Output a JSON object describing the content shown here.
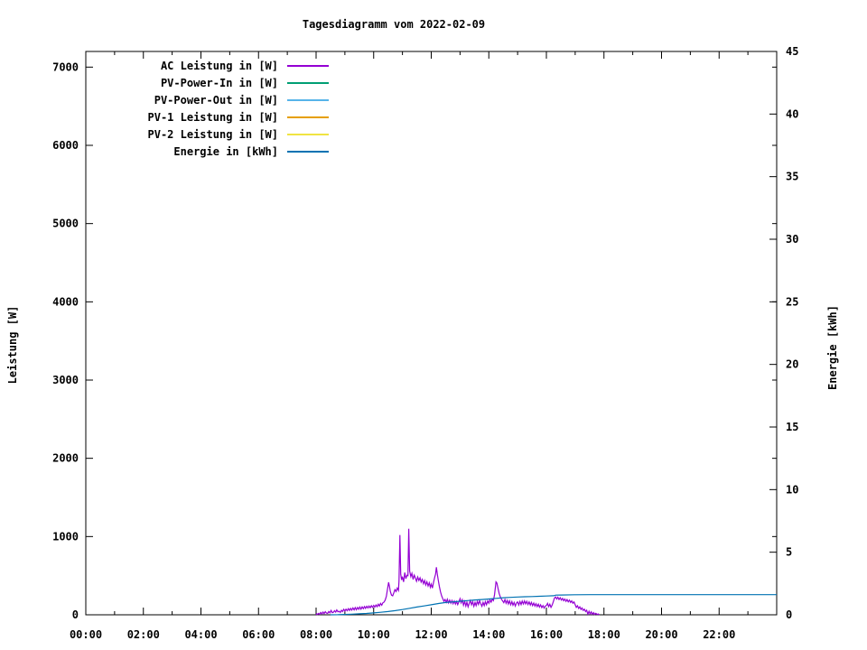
{
  "chart_data": {
    "type": "line",
    "title": "Tagesdiagramm vom 2022-02-09",
    "legend_position": "top-left",
    "grid": false,
    "background": "#ffffff",
    "x": {
      "min": 0,
      "max": 24,
      "major": [
        0,
        2,
        4,
        6,
        8,
        10,
        12,
        14,
        16,
        18,
        20,
        22
      ],
      "major_labels": [
        "00:00",
        "02:00",
        "04:00",
        "06:00",
        "08:00",
        "10:00",
        "12:00",
        "14:00",
        "16:00",
        "18:00",
        "20:00",
        "22:00"
      ],
      "minor": [
        1,
        3,
        5,
        7,
        9,
        11,
        13,
        15,
        17,
        19,
        21,
        23
      ]
    },
    "y_left": {
      "label": "Leistung [W]",
      "min": 0,
      "max": 7200,
      "ticks": [
        0,
        1000,
        2000,
        3000,
        4000,
        5000,
        6000,
        7000
      ]
    },
    "y_right": {
      "label": "Energie [kWh]",
      "min": 0,
      "max": 45,
      "ticks": [
        0,
        5,
        10,
        15,
        20,
        25,
        30,
        35,
        40,
        45
      ]
    },
    "series": [
      {
        "name": "AC Leistung in [W]",
        "color": "#9400d3",
        "axis": "left",
        "points": [
          [
            8.0,
            0
          ],
          [
            8.02,
            12
          ],
          [
            8.04,
            3
          ],
          [
            8.08,
            18
          ],
          [
            8.12,
            6
          ],
          [
            8.16,
            30
          ],
          [
            8.2,
            12
          ],
          [
            8.24,
            35
          ],
          [
            8.28,
            15
          ],
          [
            8.32,
            40
          ],
          [
            8.36,
            22
          ],
          [
            8.4,
            18
          ],
          [
            8.44,
            42
          ],
          [
            8.48,
            25
          ],
          [
            8.52,
            55
          ],
          [
            8.56,
            28
          ],
          [
            8.6,
            32
          ],
          [
            8.64,
            52
          ],
          [
            8.68,
            35
          ],
          [
            8.72,
            62
          ],
          [
            8.76,
            38
          ],
          [
            8.8,
            45
          ],
          [
            8.84,
            30
          ],
          [
            8.88,
            58
          ],
          [
            8.92,
            42
          ],
          [
            8.96,
            70
          ],
          [
            9.0,
            48
          ],
          [
            9.04,
            72
          ],
          [
            9.08,
            52
          ],
          [
            9.12,
            78
          ],
          [
            9.16,
            55
          ],
          [
            9.2,
            82
          ],
          [
            9.24,
            60
          ],
          [
            9.28,
            88
          ],
          [
            9.32,
            62
          ],
          [
            9.36,
            92
          ],
          [
            9.4,
            65
          ],
          [
            9.44,
            95
          ],
          [
            9.48,
            70
          ],
          [
            9.52,
            100
          ],
          [
            9.56,
            72
          ],
          [
            9.6,
            102
          ],
          [
            9.64,
            78
          ],
          [
            9.68,
            106
          ],
          [
            9.72,
            82
          ],
          [
            9.76,
            110
          ],
          [
            9.8,
            86
          ],
          [
            9.84,
            112
          ],
          [
            9.88,
            90
          ],
          [
            9.92,
            116
          ],
          [
            9.96,
            95
          ],
          [
            10.0,
            120
          ],
          [
            10.04,
            98
          ],
          [
            10.08,
            126
          ],
          [
            10.12,
            104
          ],
          [
            10.16,
            135
          ],
          [
            10.2,
            112
          ],
          [
            10.24,
            145
          ],
          [
            10.28,
            122
          ],
          [
            10.32,
            152
          ],
          [
            10.36,
            162
          ],
          [
            10.4,
            188
          ],
          [
            10.44,
            235
          ],
          [
            10.48,
            330
          ],
          [
            10.52,
            415
          ],
          [
            10.55,
            360
          ],
          [
            10.58,
            298
          ],
          [
            10.62,
            252
          ],
          [
            10.66,
            242
          ],
          [
            10.7,
            282
          ],
          [
            10.74,
            322
          ],
          [
            10.78,
            298
          ],
          [
            10.82,
            342
          ],
          [
            10.86,
            312
          ],
          [
            10.88,
            430
          ],
          [
            10.91,
            1020
          ],
          [
            10.94,
            520
          ],
          [
            10.97,
            445
          ],
          [
            11.0,
            488
          ],
          [
            11.04,
            420
          ],
          [
            11.08,
            540
          ],
          [
            11.12,
            462
          ],
          [
            11.16,
            505
          ],
          [
            11.19,
            500
          ],
          [
            11.22,
            1100
          ],
          [
            11.25,
            560
          ],
          [
            11.29,
            488
          ],
          [
            11.33,
            530
          ],
          [
            11.37,
            452
          ],
          [
            11.41,
            508
          ],
          [
            11.45,
            468
          ],
          [
            11.49,
            428
          ],
          [
            11.53,
            482
          ],
          [
            11.57,
            438
          ],
          [
            11.61,
            472
          ],
          [
            11.65,
            418
          ],
          [
            11.69,
            452
          ],
          [
            11.73,
            398
          ],
          [
            11.77,
            438
          ],
          [
            11.81,
            382
          ],
          [
            11.85,
            422
          ],
          [
            11.89,
            368
          ],
          [
            11.93,
            408
          ],
          [
            11.97,
            352
          ],
          [
            12.0,
            392
          ],
          [
            12.04,
            342
          ],
          [
            12.08,
            418
          ],
          [
            12.12,
            478
          ],
          [
            12.15,
            520
          ],
          [
            12.18,
            608
          ],
          [
            12.21,
            522
          ],
          [
            12.24,
            448
          ],
          [
            12.28,
            368
          ],
          [
            12.32,
            295
          ],
          [
            12.36,
            242
          ],
          [
            12.4,
            205
          ],
          [
            12.44,
            172
          ],
          [
            12.48,
            195
          ],
          [
            12.52,
            158
          ],
          [
            12.56,
            198
          ],
          [
            12.6,
            152
          ],
          [
            12.64,
            188
          ],
          [
            12.68,
            148
          ],
          [
            12.72,
            182
          ],
          [
            12.76,
            142
          ],
          [
            12.8,
            176
          ],
          [
            12.84,
            136
          ],
          [
            12.88,
            170
          ],
          [
            12.92,
            130
          ],
          [
            12.96,
            164
          ],
          [
            13.0,
            205
          ],
          [
            13.04,
            152
          ],
          [
            13.08,
            192
          ],
          [
            13.12,
            122
          ],
          [
            13.16,
            172
          ],
          [
            13.2,
            112
          ],
          [
            13.24,
            162
          ],
          [
            13.28,
            102
          ],
          [
            13.32,
            148
          ],
          [
            13.36,
            182
          ],
          [
            13.4,
            128
          ],
          [
            13.44,
            168
          ],
          [
            13.48,
            108
          ],
          [
            13.52,
            158
          ],
          [
            13.56,
            118
          ],
          [
            13.6,
            172
          ],
          [
            13.64,
            132
          ],
          [
            13.68,
            182
          ],
          [
            13.72,
            142
          ],
          [
            13.76,
            108
          ],
          [
            13.8,
            158
          ],
          [
            13.84,
            118
          ],
          [
            13.88,
            168
          ],
          [
            13.92,
            128
          ],
          [
            13.96,
            178
          ],
          [
            14.0,
            148
          ],
          [
            14.04,
            192
          ],
          [
            14.08,
            162
          ],
          [
            14.12,
            202
          ],
          [
            14.16,
            182
          ],
          [
            14.2,
            258
          ],
          [
            14.25,
            420
          ],
          [
            14.28,
            405
          ],
          [
            14.32,
            335
          ],
          [
            14.36,
            272
          ],
          [
            14.4,
            228
          ],
          [
            14.44,
            198
          ],
          [
            14.48,
            178
          ],
          [
            14.52,
            155
          ],
          [
            14.56,
            195
          ],
          [
            14.6,
            148
          ],
          [
            14.64,
            185
          ],
          [
            14.68,
            138
          ],
          [
            14.72,
            178
          ],
          [
            14.76,
            128
          ],
          [
            14.8,
            168
          ],
          [
            14.84,
            122
          ],
          [
            14.88,
            158
          ],
          [
            14.92,
            112
          ],
          [
            14.96,
            152
          ],
          [
            15.0,
            165
          ],
          [
            15.04,
            125
          ],
          [
            15.08,
            170
          ],
          [
            15.12,
            130
          ],
          [
            15.16,
            175
          ],
          [
            15.2,
            138
          ],
          [
            15.24,
            178
          ],
          [
            15.28,
            140
          ],
          [
            15.32,
            172
          ],
          [
            15.36,
            132
          ],
          [
            15.4,
            165
          ],
          [
            15.44,
            125
          ],
          [
            15.48,
            158
          ],
          [
            15.52,
            118
          ],
          [
            15.56,
            150
          ],
          [
            15.6,
            112
          ],
          [
            15.64,
            142
          ],
          [
            15.68,
            105
          ],
          [
            15.72,
            135
          ],
          [
            15.76,
            98
          ],
          [
            15.8,
            128
          ],
          [
            15.84,
            92
          ],
          [
            15.88,
            118
          ],
          [
            15.92,
            85
          ],
          [
            15.96,
            112
          ],
          [
            16.0,
            118
          ],
          [
            16.04,
            145
          ],
          [
            16.08,
            105
          ],
          [
            16.12,
            135
          ],
          [
            16.16,
            95
          ],
          [
            16.2,
            125
          ],
          [
            16.24,
            165
          ],
          [
            16.28,
            212
          ],
          [
            16.32,
            228
          ],
          [
            16.36,
            202
          ],
          [
            16.4,
            225
          ],
          [
            16.44,
            195
          ],
          [
            16.48,
            218
          ],
          [
            16.52,
            188
          ],
          [
            16.56,
            210
          ],
          [
            16.6,
            180
          ],
          [
            16.64,
            202
          ],
          [
            16.68,
            172
          ],
          [
            16.72,
            195
          ],
          [
            16.76,
            165
          ],
          [
            16.8,
            188
          ],
          [
            16.84,
            158
          ],
          [
            16.88,
            178
          ],
          [
            16.92,
            148
          ],
          [
            16.96,
            165
          ],
          [
            17.0,
            128
          ],
          [
            17.04,
            95
          ],
          [
            17.08,
            115
          ],
          [
            17.12,
            82
          ],
          [
            17.16,
            102
          ],
          [
            17.2,
            68
          ],
          [
            17.24,
            88
          ],
          [
            17.28,
            55
          ],
          [
            17.32,
            72
          ],
          [
            17.36,
            42
          ],
          [
            17.4,
            58
          ],
          [
            17.44,
            8
          ],
          [
            17.48,
            45
          ],
          [
            17.52,
            10
          ],
          [
            17.56,
            38
          ],
          [
            17.6,
            6
          ],
          [
            17.64,
            28
          ],
          [
            17.68,
            4
          ],
          [
            17.72,
            18
          ],
          [
            17.76,
            3
          ],
          [
            17.8,
            10
          ],
          [
            17.84,
            0
          ]
        ]
      },
      {
        "name": "PV-Power-In in [W]",
        "color": "#009e73",
        "axis": "left",
        "points": []
      },
      {
        "name": "PV-Power-Out in [W]",
        "color": "#56b4e9",
        "axis": "left",
        "points": []
      },
      {
        "name": "PV-1 Leistung in [W]",
        "color": "#e69f00",
        "axis": "left",
        "points": []
      },
      {
        "name": "PV-2 Leistung in [W]",
        "color": "#f0e442",
        "axis": "left",
        "points": []
      },
      {
        "name": "Energie in [kWh]",
        "color": "#0072b2",
        "axis": "right",
        "points": [
          [
            8.5,
            0
          ],
          [
            8.75,
            0.01
          ],
          [
            9.0,
            0.03
          ],
          [
            9.25,
            0.05
          ],
          [
            9.5,
            0.08
          ],
          [
            9.75,
            0.11
          ],
          [
            10.0,
            0.15
          ],
          [
            10.25,
            0.2
          ],
          [
            10.5,
            0.26
          ],
          [
            10.75,
            0.33
          ],
          [
            11.0,
            0.42
          ],
          [
            11.25,
            0.52
          ],
          [
            11.5,
            0.62
          ],
          [
            11.75,
            0.71
          ],
          [
            12.0,
            0.8
          ],
          [
            12.25,
            0.9
          ],
          [
            12.5,
            0.98
          ],
          [
            12.75,
            1.03
          ],
          [
            13.0,
            1.08
          ],
          [
            13.25,
            1.13
          ],
          [
            13.5,
            1.18
          ],
          [
            13.75,
            1.22
          ],
          [
            14.0,
            1.26
          ],
          [
            14.25,
            1.31
          ],
          [
            14.5,
            1.36
          ],
          [
            14.75,
            1.39
          ],
          [
            15.0,
            1.42
          ],
          [
            15.25,
            1.44
          ],
          [
            15.5,
            1.46
          ],
          [
            15.75,
            1.48
          ],
          [
            16.0,
            1.5
          ],
          [
            16.25,
            1.52
          ],
          [
            16.33,
            1.57
          ],
          [
            16.5,
            1.58
          ],
          [
            17.0,
            1.6
          ],
          [
            17.5,
            1.61
          ],
          [
            18.0,
            1.61
          ],
          [
            24.0,
            1.61
          ]
        ]
      }
    ],
    "axis_color": "#000000",
    "text_color": "#000000"
  }
}
